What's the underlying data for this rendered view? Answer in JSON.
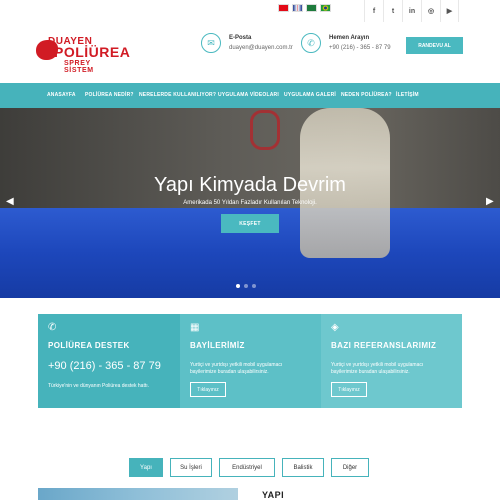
{
  "topbar": {
    "languages": [
      {
        "name": "turkish-flag-icon",
        "color": "#e30a17"
      },
      {
        "name": "english-flag-icon",
        "color": "#1f3a93"
      },
      {
        "name": "arabic-flag-icon",
        "color": "#1e7b3c"
      },
      {
        "name": "portuguese-flag-icon",
        "color": "#1f9a3a"
      }
    ],
    "social": [
      {
        "name": "facebook-icon",
        "glyph": "f"
      },
      {
        "name": "twitter-icon",
        "glyph": "t"
      },
      {
        "name": "linkedin-icon",
        "glyph": "in"
      },
      {
        "name": "instagram-icon",
        "glyph": "◎"
      },
      {
        "name": "youtube-icon",
        "glyph": "▶"
      }
    ]
  },
  "brand": {
    "line1": "DUAYEN",
    "line2": "POLİÜREA",
    "line3": "SPREY SİSTEM",
    "color": "#d11b24"
  },
  "header": {
    "email_title": "E-Posta",
    "email_value": "duayen@duayen.com.tr",
    "phone_title": "Hemen Arayın",
    "phone_value": "+90 (216) - 365 - 87 79",
    "appointment_label": "RANDEVU AL"
  },
  "nav": {
    "items": [
      "ANASAYFA",
      "POLİÜREA NEDİR?",
      "NERELERDE KULLANILIYOR?",
      "UYGULAMA VİDEOLARI",
      "UYGULAMA GALERİ",
      "NEDEN POLİÜREA?",
      "İLETİŞİM"
    ],
    "active": 0
  },
  "hero": {
    "title": "Yapı Kimyada Devrim",
    "subtitle": "Amerikada 50 Yıldan Fazladır Kullanılan Teknoloji.",
    "button_label": "KEŞFET",
    "slide_count": 3,
    "active_slide": 0
  },
  "features": [
    {
      "title": "POLİÜREA DESTEK",
      "phone": "+90 (216) - 365 - 87 79",
      "description": "Türkiye'nin ve dünyanın Poliürea destek hattı."
    },
    {
      "title": "BAYİLERİMİZ",
      "description": "Yurtiçi ve yurtdışı yetkili mobil uygulamacı bayilerimize buradan ulaşabilirsiniz.",
      "button_label": "Tıklayınız"
    },
    {
      "title": "BAZI REFERANSLARIMIZ",
      "description": "Yurtiçi ve yurtdışı yetkili mobil uygulamacı bayilerimize buradan ulaşabilirsiniz.",
      "button_label": "Tıklayınız"
    }
  ],
  "tabs": {
    "items": [
      "Yapı",
      "Su İşleri",
      "Endüstriyel",
      "Balistik",
      "Diğer"
    ],
    "active": 0
  },
  "section": {
    "heading": "YAPI"
  },
  "colors": {
    "accent": "#46b3bb",
    "brand_red": "#d11b24"
  }
}
